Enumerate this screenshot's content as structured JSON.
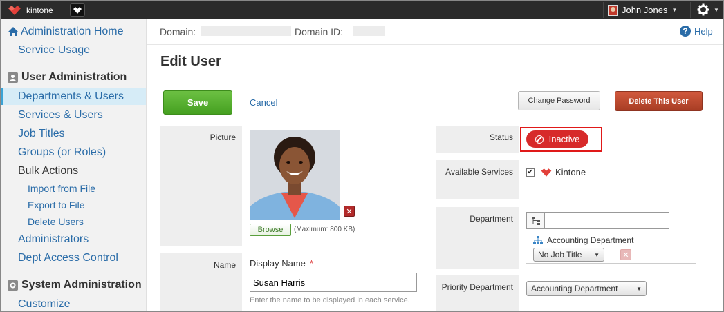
{
  "topbar": {
    "app_name": "kintone",
    "user_name": "John Jones"
  },
  "sidebar": {
    "home": "Administration Home",
    "service_usage": "Service Usage",
    "user_admin_heading": "User Administration",
    "items": [
      {
        "label": "Departments & Users"
      },
      {
        "label": "Services & Users"
      },
      {
        "label": "Job Titles"
      },
      {
        "label": "Groups (or Roles)"
      },
      {
        "label": "Bulk Actions"
      }
    ],
    "bulk_sub": [
      {
        "label": "Import from File"
      },
      {
        "label": "Export to File"
      },
      {
        "label": "Delete Users"
      }
    ],
    "administrators": "Administrators",
    "dept_access": "Dept Access Control",
    "system_admin_heading": "System Administration",
    "customize": "Customize"
  },
  "domain_bar": {
    "domain_label": "Domain:",
    "domain_id_label": "Domain ID:",
    "help": "Help"
  },
  "page": {
    "title": "Edit User"
  },
  "actions": {
    "save": "Save",
    "cancel": "Cancel",
    "change_password": "Change Password",
    "delete_user": "Delete This User"
  },
  "form": {
    "picture_label": "Picture",
    "browse": "Browse",
    "max_note": "(Maximum: 800 KB)",
    "name_label": "Name",
    "display_name_label": "Display Name",
    "required_mark": "*",
    "display_name_value": "Susan Harris",
    "display_name_hint": "Enter the name to be displayed in each service.",
    "status_label": "Status",
    "status_value": "Inactive",
    "available_services_label": "Available Services",
    "service_name": "Kintone",
    "service_checked": true,
    "department_label": "Department",
    "department_value": "Accounting Department",
    "job_title_value": "No Job Title",
    "priority_department_label": "Priority Department",
    "priority_department_value": "Accounting Department"
  },
  "colors": {
    "accent": "#2a6ca8",
    "save": "#45a020",
    "delete": "#a83d24",
    "inactive": "#d72a2a",
    "highlight": "#e01919"
  }
}
